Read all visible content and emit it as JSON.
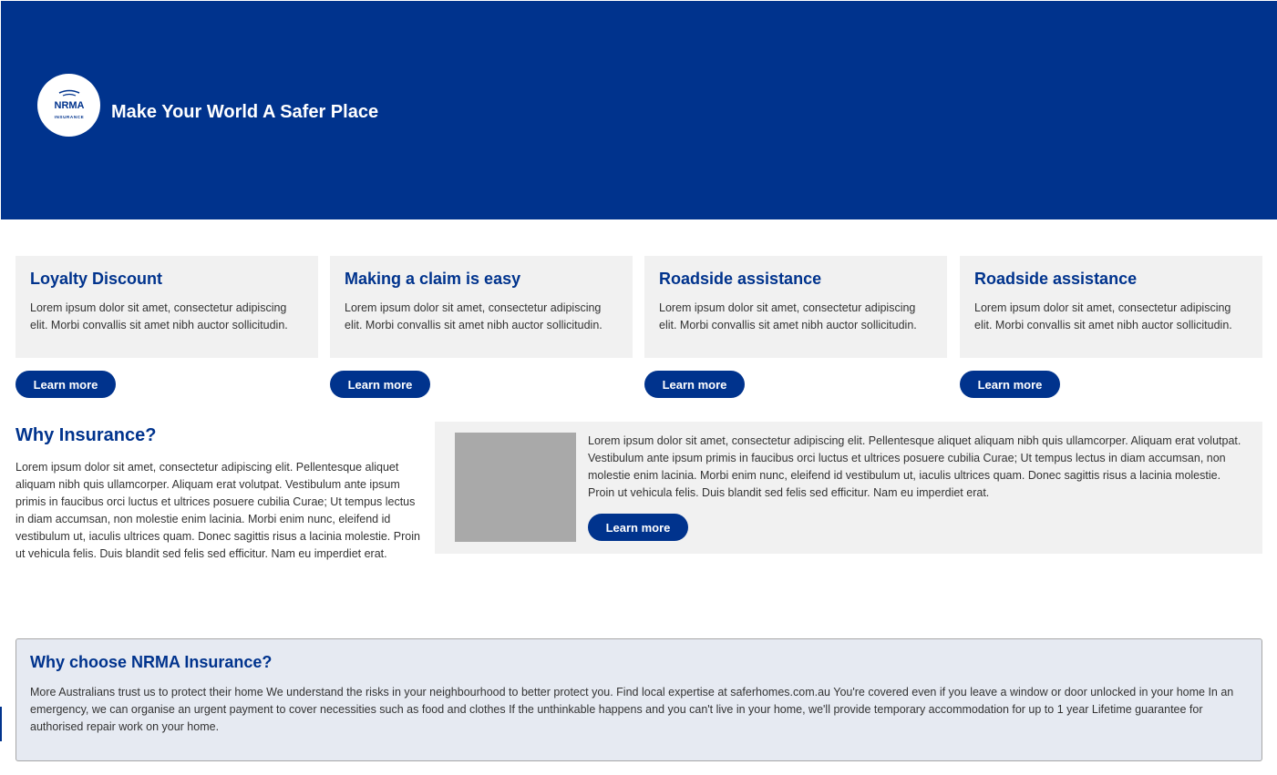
{
  "hero": {
    "title": "Make Your World A Safer Place",
    "logo_text": "NRMA",
    "logo_subtext": "INSURANCE"
  },
  "cards": [
    {
      "title": "Loyalty Discount",
      "text": "Lorem ipsum dolor sit amet, consectetur adipiscing elit. Morbi convallis sit amet nibh auctor sollicitudin.",
      "button": "Learn more"
    },
    {
      "title": "Making a claim is easy",
      "text": "Lorem ipsum dolor sit amet, consectetur adipiscing elit. Morbi convallis sit amet nibh auctor sollicitudin.",
      "button": "Learn more"
    },
    {
      "title": "Roadside assistance",
      "text": "Lorem ipsum dolor sit amet, consectetur adipiscing elit. Morbi convallis sit amet nibh auctor sollicitudin.",
      "button": "Learn more"
    },
    {
      "title": "Roadside assistance",
      "text": "Lorem ipsum dolor sit amet, consectetur adipiscing elit. Morbi convallis sit amet nibh auctor sollicitudin.",
      "button": "Learn more"
    }
  ],
  "why": {
    "title": "Why Insurance?",
    "text": "Lorem ipsum dolor sit amet, consectetur adipiscing elit. Pellentesque aliquet aliquam nibh quis ullamcorper. Aliquam erat volutpat. Vestibulum ante ipsum primis in faucibus orci luctus et ultrices posuere cubilia Curae; Ut tempus lectus in diam accumsan, non molestie enim lacinia. Morbi enim nunc, eleifend id vestibulum ut, iaculis ultrices quam. Donec sagittis risus a lacinia molestie. Proin ut vehicula felis. Duis blandit sed felis sed efficitur. Nam eu imperdiet erat."
  },
  "feature": {
    "text": "Lorem ipsum dolor sit amet, consectetur adipiscing elit. Pellentesque aliquet aliquam nibh quis ullamcorper. Aliquam erat volutpat. Vestibulum ante ipsum primis in faucibus orci luctus et ultrices posuere cubilia Curae; Ut tempus lectus in diam accumsan, non molestie enim lacinia. Morbi enim nunc, eleifend id vestibulum ut, iaculis ultrices quam. Donec sagittis risus a lacinia molestie. Proin ut vehicula felis. Duis blandit sed felis sed efficitur. Nam eu imperdiet erat.",
    "button": "Learn more"
  },
  "choose": {
    "title": "Why choose NRMA Insurance?",
    "text": "More Australians trust us to protect their home We understand the risks in your neighbourhood to better protect you. Find local expertise at saferhomes.com.au You're covered even if you leave a window or door unlocked in your home In an emergency, we can organise an urgent payment to cover necessities such as food and clothes If the unthinkable happens and you can't live in your home, we'll provide temporary accommodation for up to 1 year Lifetime guarantee for authorised repair work on your home."
  },
  "colors": {
    "brand_blue": "#00338d",
    "card_bg": "#f1f1f1",
    "choose_bg": "#e6eaf2",
    "image_placeholder": "#a9a9a9"
  }
}
